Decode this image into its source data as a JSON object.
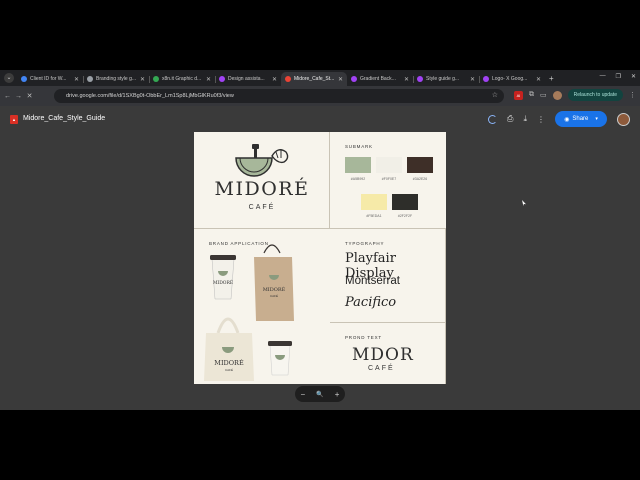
{
  "tabs": [
    {
      "label": "Client ID for W...",
      "color": "#4285f4",
      "active": false
    },
    {
      "label": "Branding style g...",
      "color": "#9aa0a6",
      "active": false
    },
    {
      "label": "x8n.it Graphic d...",
      "color": "#34a853",
      "active": false
    },
    {
      "label": "Design assista...",
      "color": "#a142f4",
      "active": false
    },
    {
      "label": "Midore_Cafe_St...",
      "color": "#ea4335",
      "active": true
    },
    {
      "label": "Gradient Back...",
      "color": "#a142f4",
      "active": false
    },
    {
      "label": "Style guide g...",
      "color": "#a142f4",
      "active": false
    },
    {
      "label": "Logo- X Goog...",
      "color": "#a142f4",
      "active": false
    }
  ],
  "address_bar": {
    "url": "drive.google.com/file/d/1SXBg0t-ObbEr_Lm1Sp8LjMbGlKRu0f3/view"
  },
  "toolbar": {
    "relaunch_label": "Relaunch to update",
    "ext_label": "AI"
  },
  "viewer": {
    "file_name": "Midore_Cafe_Style_Guide",
    "share_label": "Share"
  },
  "doc": {
    "logo": {
      "name": "MIDORÉ",
      "subtitle": "CAFÉ"
    },
    "submark": {
      "label": "SUBMARK",
      "swatches": [
        {
          "color": "#a7b79a",
          "code": "#A5B992"
        },
        {
          "color": "#f1efe7",
          "code": "#F0F0E7"
        },
        {
          "color": "#3e2f28",
          "code": "#3A2E26"
        },
        {
          "color": "#f6eaa8",
          "code": "#F5EDA1"
        },
        {
          "color": "#2e2e2a",
          "code": "#2F2F2F"
        }
      ]
    },
    "typography": {
      "label": "TYPOGRAPHY",
      "fonts": [
        "Playfair Display",
        "Montserrat",
        "Pacifico"
      ]
    },
    "brand_text": {
      "label": "PROND TEXT",
      "name": "MDOR",
      "subtitle": "CAFÉ"
    },
    "brand_application": {
      "label": "BRAND APPLICATION",
      "cup_text": "MIDORÉ",
      "bag_text": "MIDORÉ",
      "tote_text": "MIDORÉ",
      "small_text": "CAFÉ"
    }
  },
  "zoom_controls": {
    "minus": "−",
    "zoom": "🔍",
    "plus": "+"
  }
}
